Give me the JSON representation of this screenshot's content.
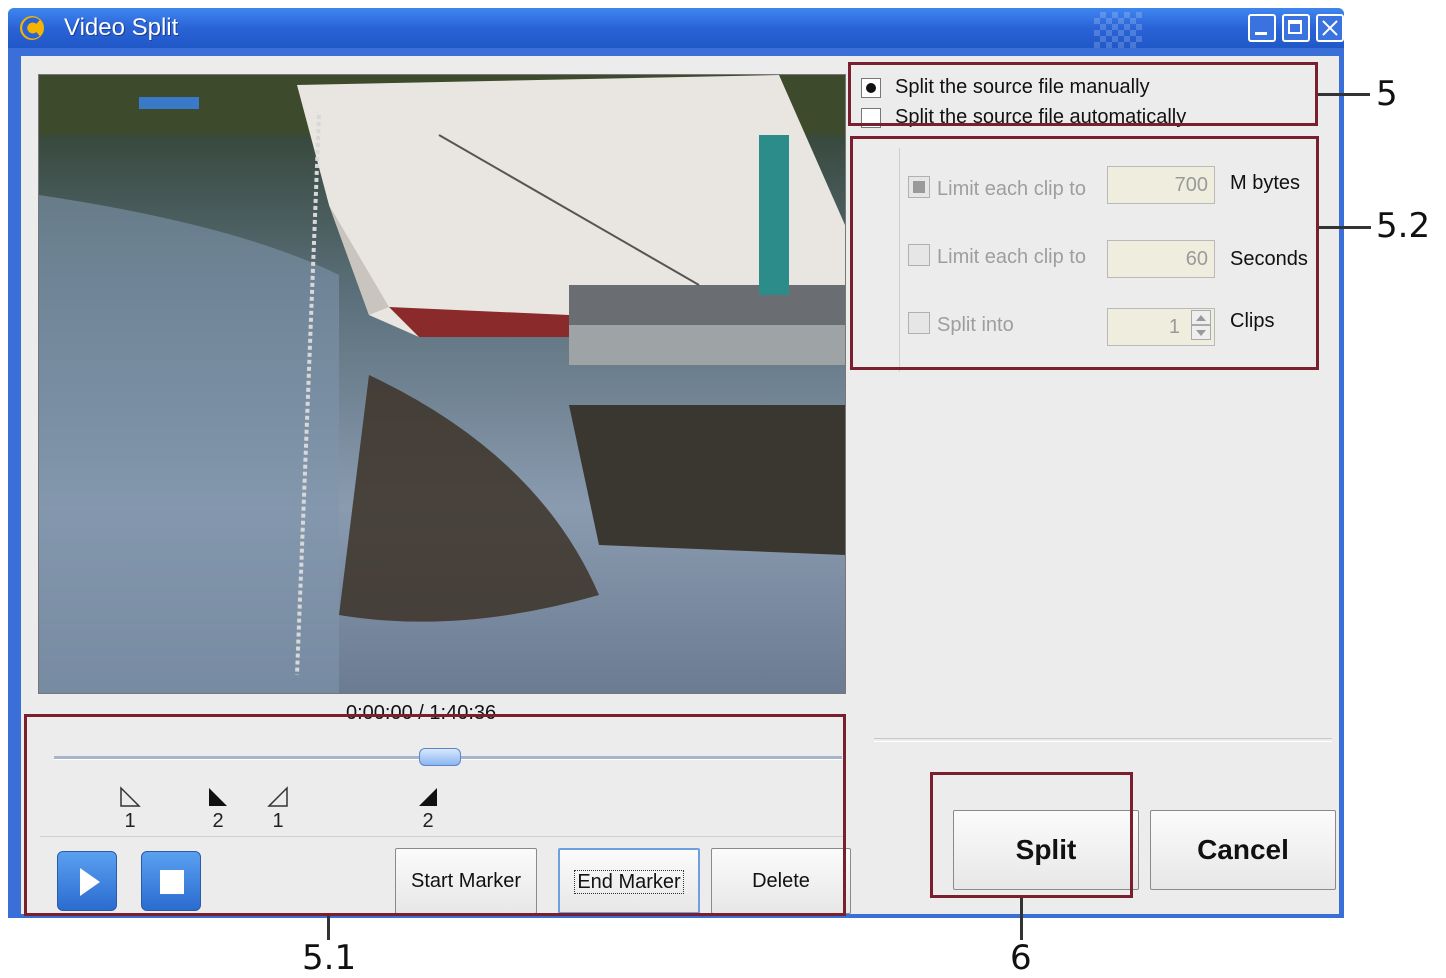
{
  "window": {
    "title": "Video Split"
  },
  "player": {
    "current_time": "0:00:00",
    "separator": "/",
    "total_time": "1:40:36",
    "slider_position_fraction": 0.49
  },
  "markers": [
    {
      "kind": "start",
      "number": "1"
    },
    {
      "kind": "end",
      "number": "2"
    },
    {
      "kind": "start",
      "number": "1"
    },
    {
      "kind": "end",
      "number": "2"
    }
  ],
  "controls": {
    "start_marker": "Start Marker",
    "end_marker": "End Marker",
    "delete": "Delete"
  },
  "split_mode": {
    "manual_label": "Split the source file manually",
    "auto_label": "Split the source file automatically",
    "selected": "manual"
  },
  "auto_options": [
    {
      "label": "Limit each clip to",
      "value": "700",
      "unit": "M bytes",
      "checked": true
    },
    {
      "label": "Limit each clip to",
      "value": "60",
      "unit": "Seconds",
      "checked": false
    },
    {
      "label": "Split into",
      "value": "1",
      "unit": "Clips",
      "checked": false
    }
  ],
  "actions": {
    "split": "Split",
    "cancel": "Cancel"
  },
  "callouts": {
    "mode": "5",
    "auto_panel": "5.2",
    "timeline": "5.1",
    "split_button": "6"
  },
  "colors": {
    "callout": "#7a1f2e",
    "titlebar": "#2a63d6"
  }
}
